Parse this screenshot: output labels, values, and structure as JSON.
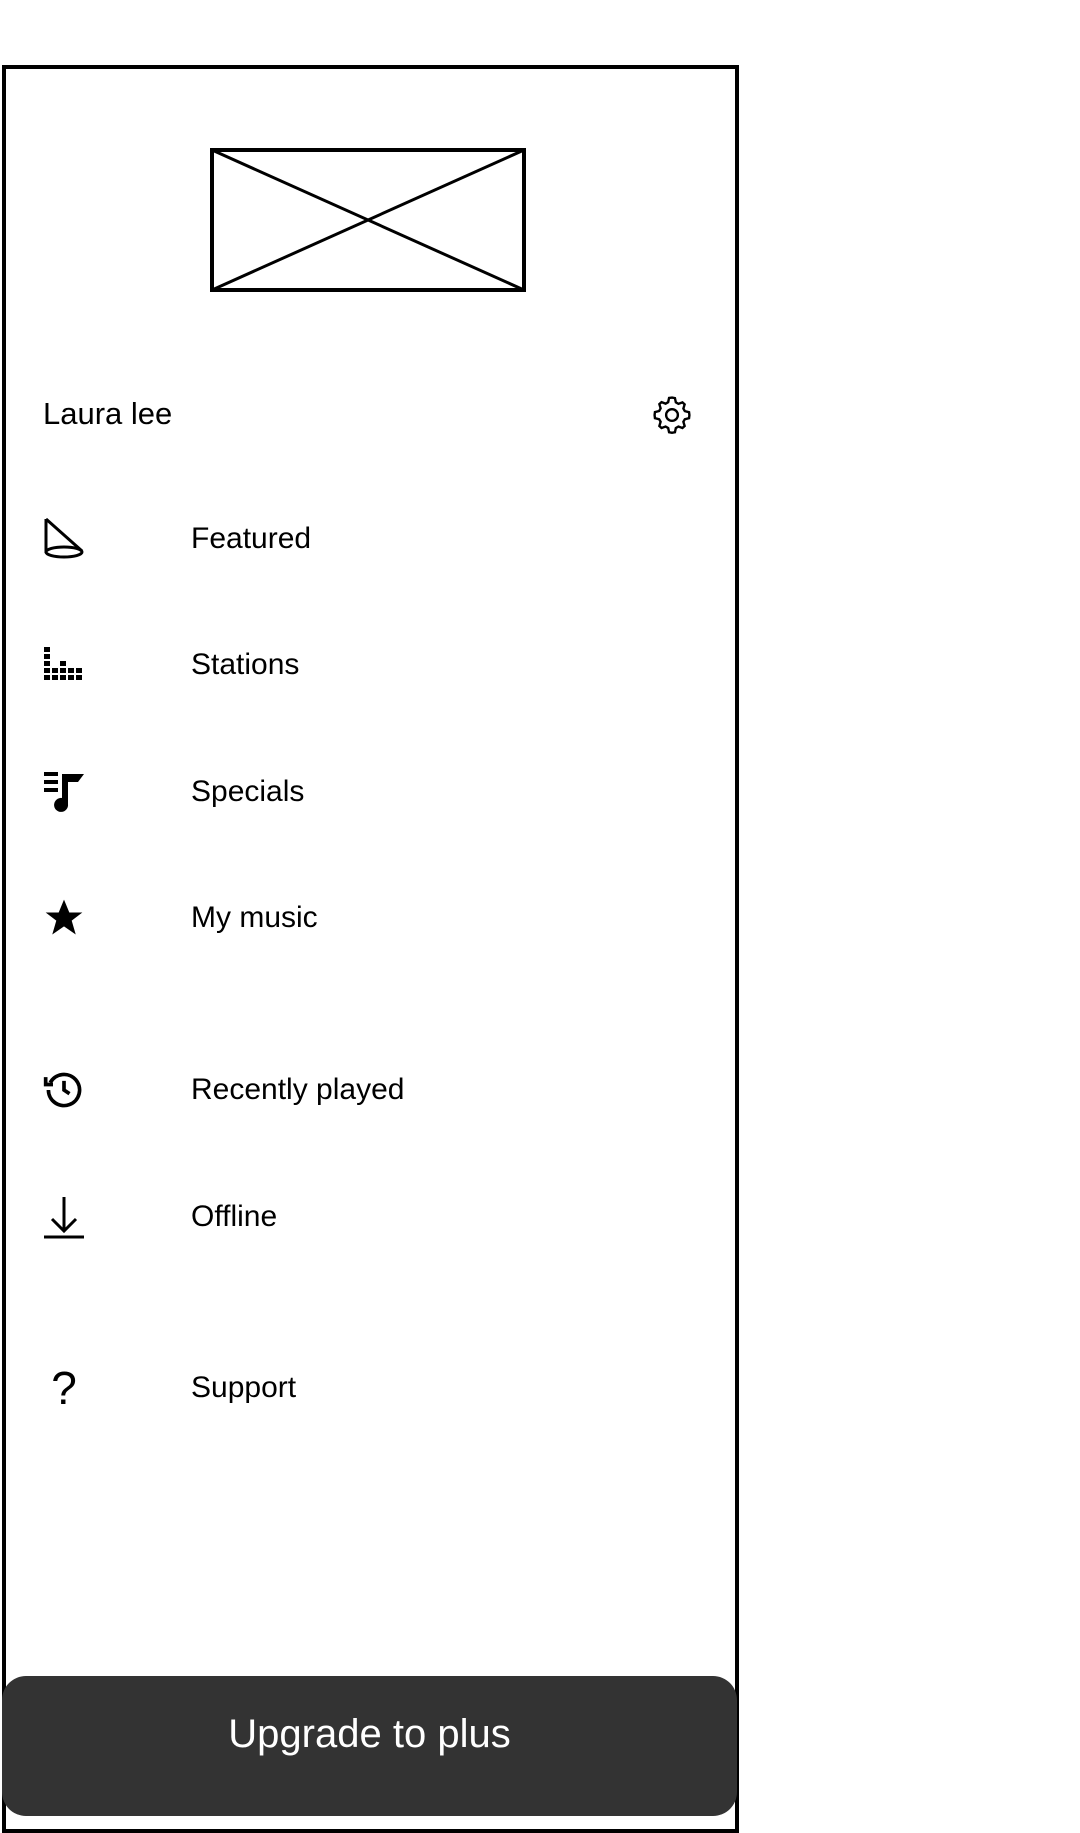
{
  "profile": {
    "name": "Laura lee",
    "settings_icon": "gear-icon"
  },
  "menu": [
    {
      "label": "Featured",
      "icon": "cone-icon"
    },
    {
      "label": "Stations",
      "icon": "equalizer-icon"
    },
    {
      "label": "Specials",
      "icon": "music-queue-icon"
    },
    {
      "label": "My music",
      "icon": "star-icon"
    },
    {
      "label": "Recently played",
      "icon": "history-icon"
    },
    {
      "label": "Offline",
      "icon": "download-icon"
    },
    {
      "label": "Support",
      "icon": "question-icon"
    }
  ],
  "upgrade_button": {
    "label": "Upgrade to plus",
    "color": "#333333"
  }
}
